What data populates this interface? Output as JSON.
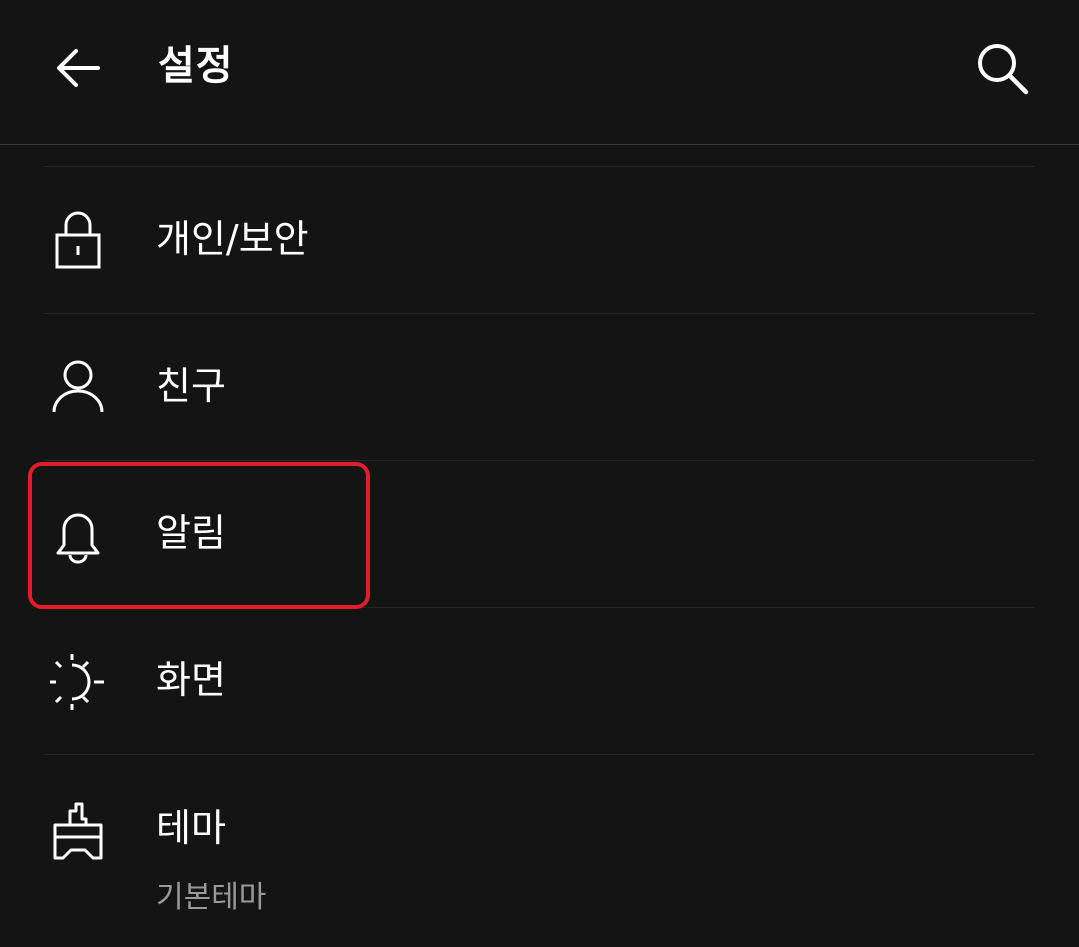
{
  "header": {
    "title": "설정",
    "back_icon": "arrow-left-icon",
    "search_icon": "search-icon"
  },
  "settings": {
    "items": [
      {
        "label": "개인/보안",
        "icon": "lock-icon"
      },
      {
        "label": "친구",
        "icon": "person-icon"
      },
      {
        "label": "알림",
        "icon": "bell-icon"
      },
      {
        "label": "화면",
        "icon": "brightness-icon"
      },
      {
        "label": "테마",
        "icon": "paint-brush-icon",
        "subtitle": "기본테마"
      }
    ]
  },
  "colors": {
    "background": "#141414",
    "text": "#ffffff",
    "subtext": "#9a9a9a",
    "divider": "#262626",
    "highlight": "#e11d2a"
  }
}
